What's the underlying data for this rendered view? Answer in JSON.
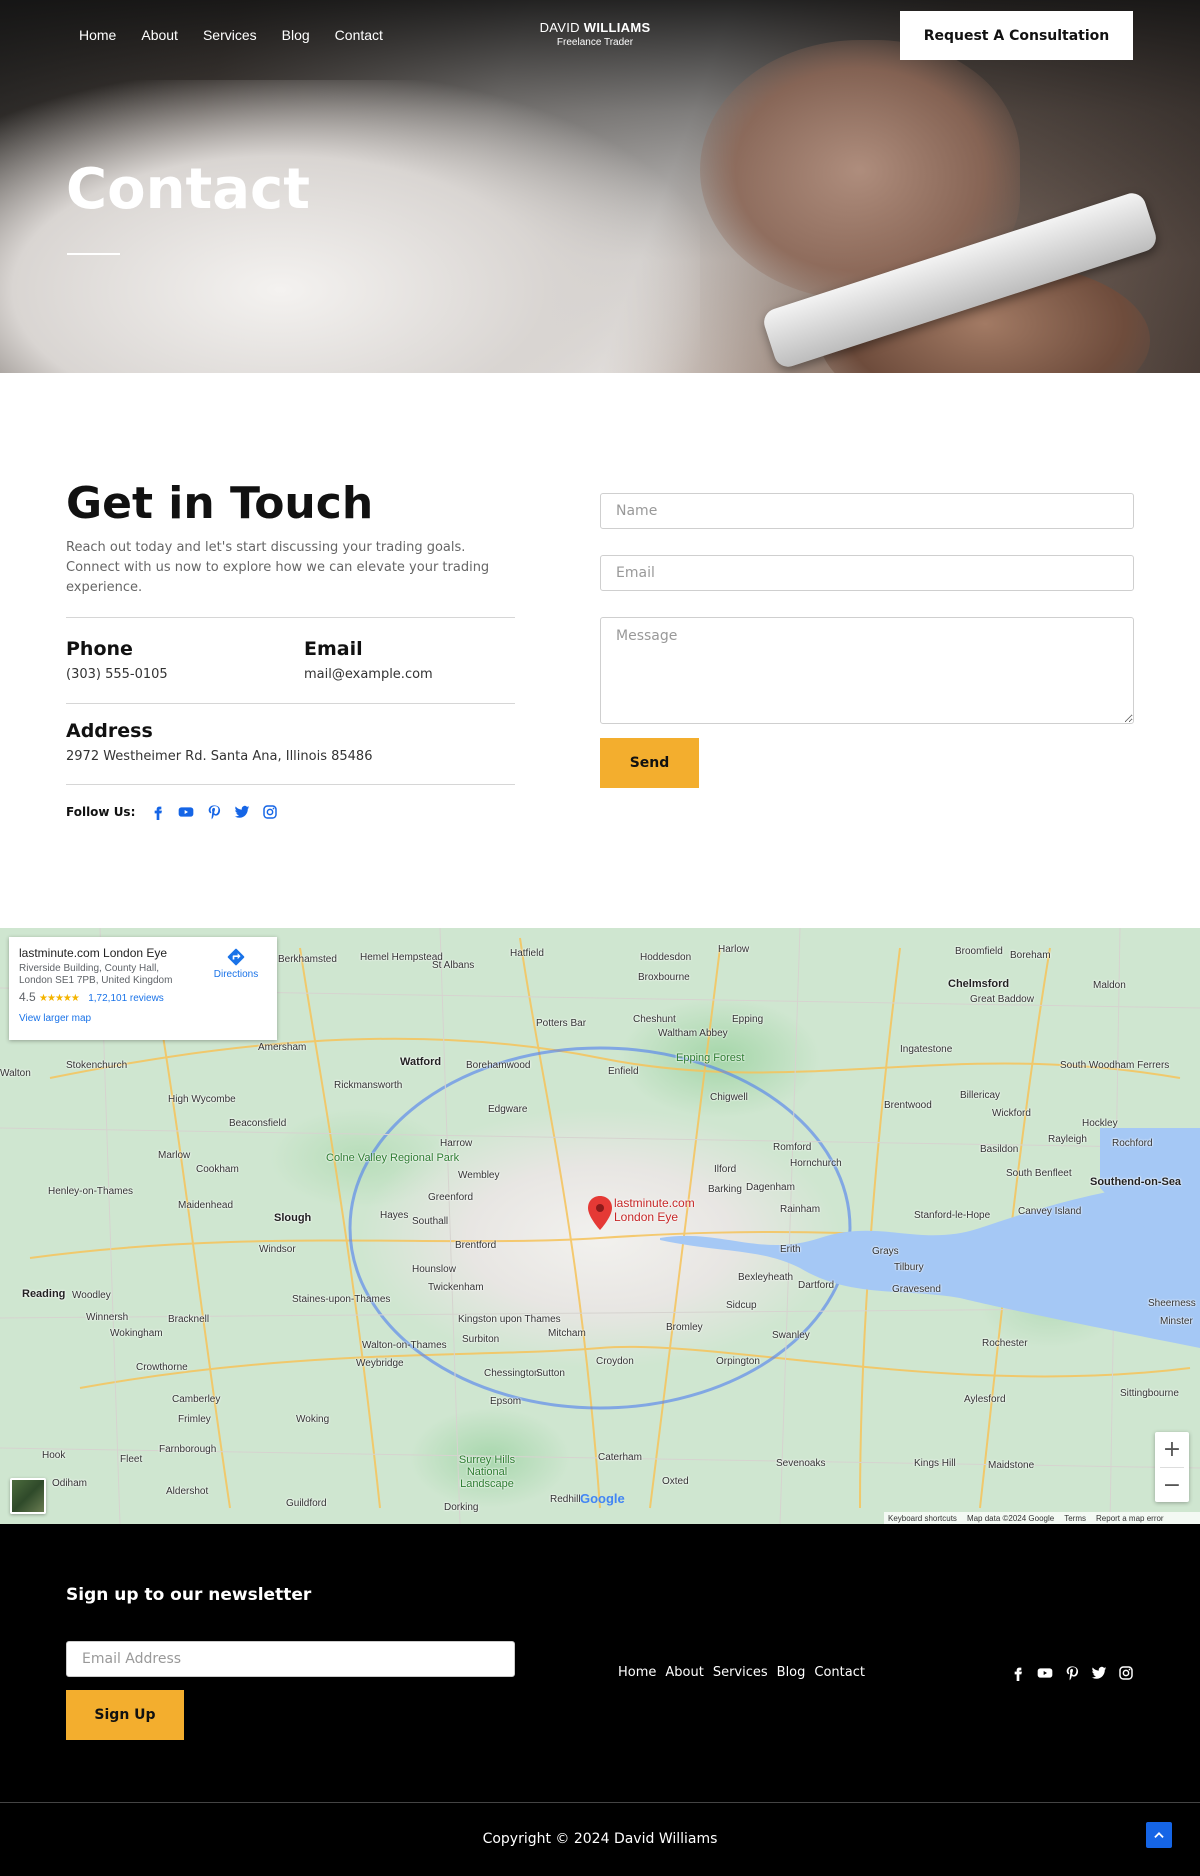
{
  "header": {
    "nav": [
      "Home",
      "About",
      "Services",
      "Blog",
      "Contact"
    ],
    "brand_first": "DAVID",
    "brand_last": "WILLIAMS",
    "brand_tagline": "Freelance Trader",
    "cta": "Request A Consultation"
  },
  "hero": {
    "title": "Contact"
  },
  "contact": {
    "title": "Get in Touch",
    "description": "Reach out today and let's start discussing your trading goals. Connect with us now to explore how we can elevate your trading experience.",
    "phone_label": "Phone",
    "phone_value": "(303) 555-0105",
    "email_label": "Email",
    "email_value": "mail@example.com",
    "address_label": "Address",
    "address_value": "2972 Westheimer Rd. Santa Ana, Illinois 85486",
    "follow_label": "Follow Us:",
    "social_icons": [
      "facebook-icon",
      "youtube-icon",
      "pinterest-icon",
      "twitter-icon",
      "instagram-icon"
    ],
    "social_color": "#1565e6"
  },
  "form": {
    "name_placeholder": "Name",
    "email_placeholder": "Email",
    "message_placeholder": "Message",
    "send_label": "Send",
    "accent": "#f3ae2e"
  },
  "map": {
    "place_title": "lastminute.com London Eye",
    "address": "Riverside Building, County Hall, London SE1 7PB, United Kingdom",
    "rating": "4.5",
    "stars": "★★★★★",
    "reviews": "1,72,101 reviews",
    "directions": "Directions",
    "view_larger": "View larger map",
    "pin_label_1": "lastminute.com",
    "pin_label_2": "London Eye",
    "zoom_in": "+",
    "zoom_out": "−",
    "google": "Google",
    "attribution": [
      "Keyboard shortcuts",
      "Map data ©2024 Google",
      "Terms",
      "Report a map error"
    ],
    "places": [
      "Berkhamsted",
      "Hemel Hempstead",
      "St Albans",
      "Hatfield",
      "Hoddesdon",
      "Harlow",
      "Broomfield",
      "Boreham",
      "Chelmsford",
      "Great Baddow",
      "Maldon",
      "Broxbourne",
      "Potters Bar",
      "Cheshunt",
      "Waltham Abbey",
      "Epping",
      "Amersham",
      "Watford",
      "Borehamwood",
      "Enfield",
      "Epping Forest",
      "Ingatestone",
      "South Woodham Ferrers",
      "Stokenchurch",
      "High Wycombe",
      "Rickmansworth",
      "Chigwell",
      "Brentwood",
      "Billericay",
      "Wickford",
      "Hockley",
      "Beaconsfield",
      "Edgware",
      "Harrow",
      "Romford",
      "Basildon",
      "Rayleigh",
      "Rochford",
      "Marlow",
      "Cookham",
      "Colne Valley Regional Park",
      "Wembley",
      "Ilford",
      "Hornchurch",
      "South Benfleet",
      "Southend-on-Sea",
      "Henley-on-Thames",
      "Maidenhead",
      "Slough",
      "Hayes",
      "Southall",
      "Greenford",
      "Barking",
      "Dagenham",
      "Rainham",
      "Stanford-le-Hope",
      "Canvey Island",
      "Windsor",
      "Brentford",
      "Erith",
      "Grays",
      "Tilbury",
      "Reading",
      "Woodley",
      "Hounslow",
      "Twickenham",
      "Bexleyheath",
      "Dartford",
      "Gravesend",
      "Sheerness",
      "Winnersh",
      "Wokingham",
      "Bracknell",
      "Staines-upon-Thames",
      "Kingston upon Thames",
      "Surbiton",
      "Mitcham",
      "Sidcup",
      "Bromley",
      "Swanley",
      "Walton-on-Thames",
      "Weybridge",
      "Croydon",
      "Orpington",
      "Rochester",
      "Crowthorne",
      "Chessington",
      "Sutton",
      "Sittingbourne",
      "Camberley",
      "Epsom",
      "Aylesford",
      "Frimley",
      "Woking",
      "Farnborough",
      "Surrey Hills National Landscape",
      "Caterham",
      "Sevenoaks",
      "Kings Hill",
      "Maidstone",
      "Hook",
      "Fleet",
      "Aldershot",
      "Odiham",
      "Guildford",
      "Dorking",
      "Redhill",
      "Oxted",
      "Walton",
      "Minster"
    ]
  },
  "footer": {
    "newsletter_title": "Sign up to our newsletter",
    "email_placeholder": "Email Address",
    "signup_label": "Sign Up",
    "nav": [
      "Home",
      "About",
      "Services",
      "Blog",
      "Contact"
    ],
    "copyright": "Copyright © 2024 David Williams"
  }
}
